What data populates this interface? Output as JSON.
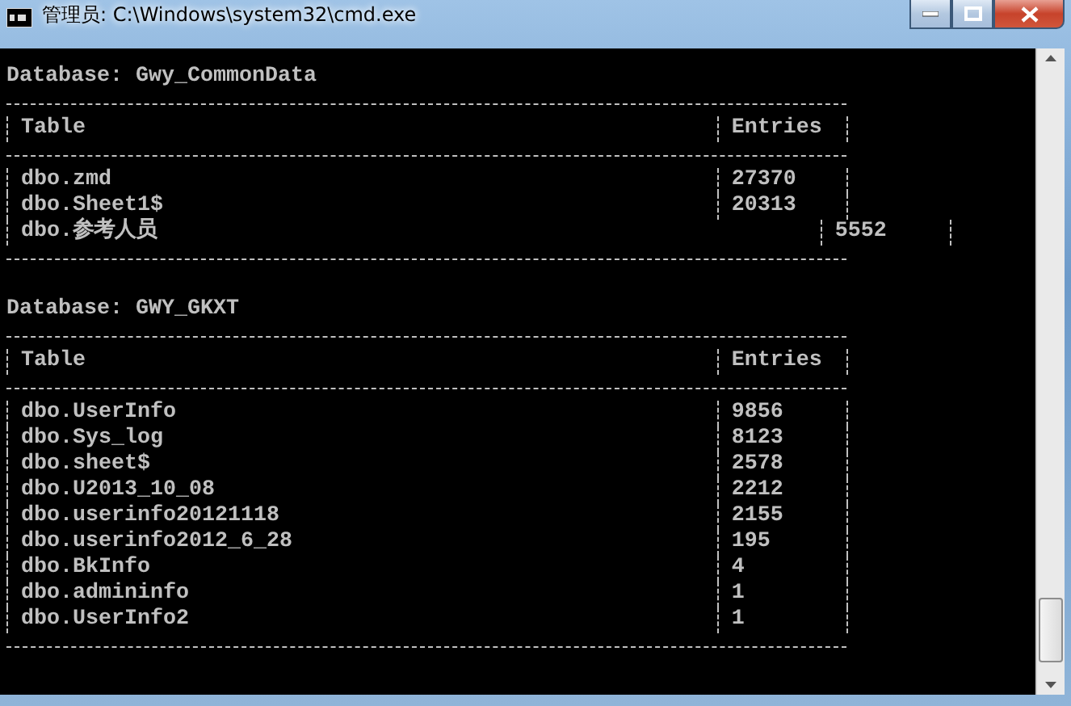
{
  "window": {
    "title": "管理员: C:\\Windows\\system32\\cmd.exe"
  },
  "databases": [
    {
      "label": "Database: Gwy_CommonData",
      "columns": [
        "Table",
        "Entries"
      ],
      "rows": [
        {
          "table": "dbo.zmd",
          "entries": "27370"
        },
        {
          "table": "dbo.Sheet1$",
          "entries": "20313"
        },
        {
          "table": "dbo.参考人员",
          "entries": "5552"
        }
      ]
    },
    {
      "label": "Database: GWY_GKXT",
      "columns": [
        "Table",
        "Entries"
      ],
      "rows": [
        {
          "table": "dbo.UserInfo",
          "entries": "9856"
        },
        {
          "table": "dbo.Sys_log",
          "entries": "8123"
        },
        {
          "table": "dbo.sheet$",
          "entries": "2578"
        },
        {
          "table": "dbo.U2013_10_08",
          "entries": "2212"
        },
        {
          "table": "dbo.userinfo20121118",
          "entries": "2155"
        },
        {
          "table": "dbo.userinfo2012_6_28",
          "entries": "195"
        },
        {
          "table": "dbo.BkInfo",
          "entries": "4"
        },
        {
          "table": "dbo.admininfo",
          "entries": "1"
        },
        {
          "table": "dbo.UserInfo2",
          "entries": "1"
        }
      ]
    }
  ]
}
